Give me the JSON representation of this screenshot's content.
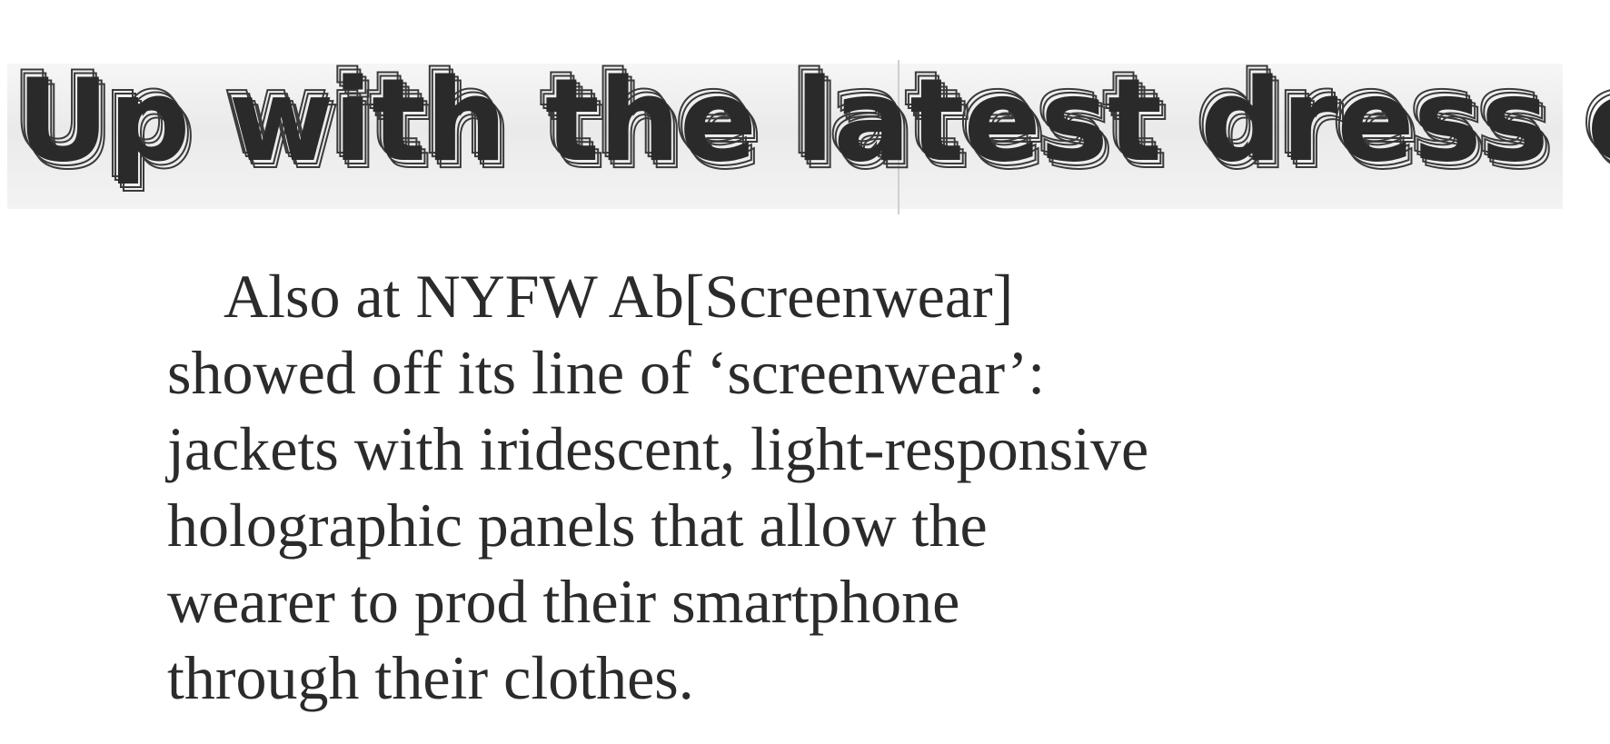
{
  "headline": {
    "text": "Up with the latest dress codes?"
  },
  "article": {
    "lines": [
      "Also at NYFW Ab[Screenwear]",
      "showed off its line of ‘screenwear’:",
      "jackets with iridescent, light-responsive",
      "holographic panels that allow the",
      "wearer to prod their smartphone",
      "through their clothes."
    ]
  },
  "colors": {
    "text": "#2b2b2b",
    "headline": "#2a2a2a",
    "band": "#eaeaea",
    "background": "#ffffff"
  }
}
